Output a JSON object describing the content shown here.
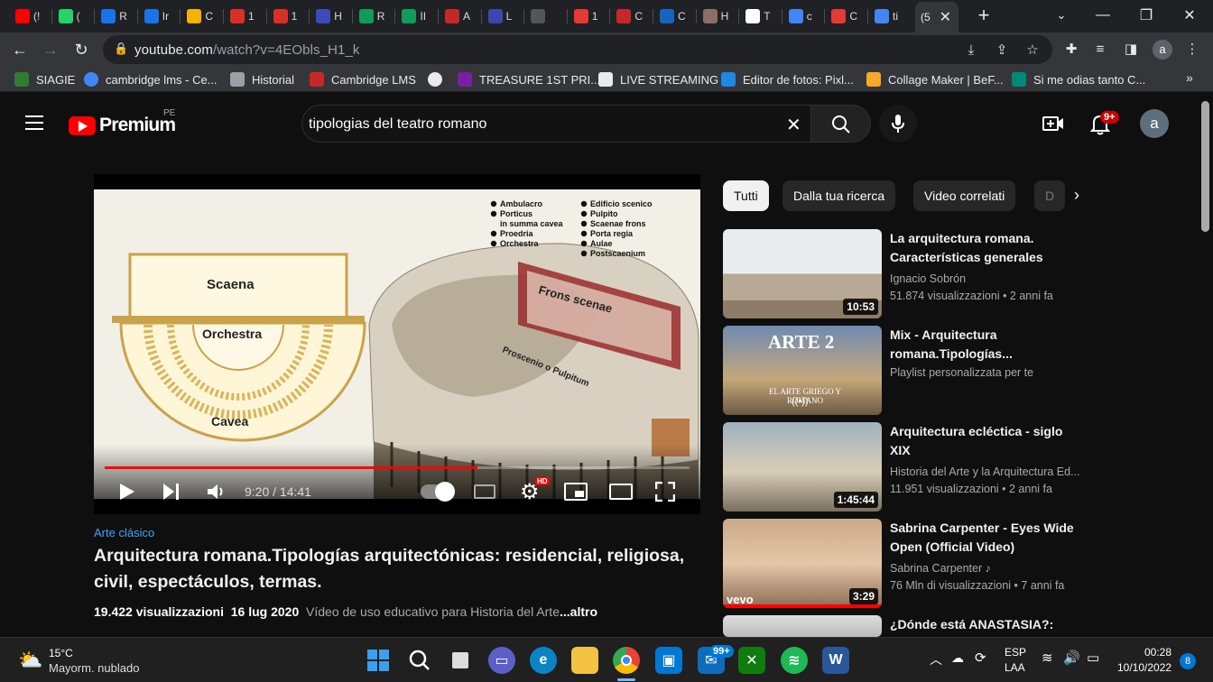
{
  "browser": {
    "tabs": [
      {
        "fav_color": "#ff0000",
        "label": "(!"
      },
      {
        "fav_color": "#25d366",
        "label": "("
      },
      {
        "fav_color": "#1a73e8",
        "label": "R"
      },
      {
        "fav_color": "#1a73e8",
        "label": "Ir"
      },
      {
        "fav_color": "#f4b400",
        "label": "C"
      },
      {
        "fav_color": "#d93025",
        "label": "1"
      },
      {
        "fav_color": "#d93025",
        "label": "1"
      },
      {
        "fav_color": "#3b4bb8",
        "label": "H"
      },
      {
        "fav_color": "#0f9d58",
        "label": "R"
      },
      {
        "fav_color": "#0f9d58",
        "label": "II"
      },
      {
        "fav_color": "#c62828",
        "label": "A"
      },
      {
        "fav_color": "#3949ab",
        "label": "L"
      },
      {
        "fav_color": "#555555",
        "label": ""
      },
      {
        "fav_color": "#e53935",
        "label": "1"
      },
      {
        "fav_color": "#c62828",
        "label": "C"
      },
      {
        "fav_color": "#1565c0",
        "label": "C"
      },
      {
        "fav_color": "#8d6e63",
        "label": "H"
      },
      {
        "fav_color": "#ffffff",
        "label": "T"
      },
      {
        "fav_color": "#4285f4",
        "label": "c"
      },
      {
        "fav_color": "#e53935",
        "label": "C"
      },
      {
        "fav_color": "#4285f4",
        "label": "ti"
      }
    ],
    "active_tab_label": "(5",
    "url_host": "youtube.com",
    "url_path": "/watch?v=4EObls_H1_k",
    "profile_initial": "a",
    "bookmarks": [
      {
        "label": "SIAGIE",
        "color": "#2e7d32"
      },
      {
        "label": "cambridge lms - Ce...",
        "color": "#4285f4"
      },
      {
        "label": "Historial",
        "color": "#9aa0a6"
      },
      {
        "label": "Cambridge LMS",
        "color": "#c62828"
      },
      {
        "label": "",
        "color": "#e8eaed"
      },
      {
        "label": "TREASURE 1ST PRI...",
        "color": "#7b1fa2"
      },
      {
        "label": "LIVE STREAMING",
        "color": "#e8eaed"
      },
      {
        "label": "Editor de fotos: Pixl...",
        "color": "#1e88e5"
      },
      {
        "label": "Collage Maker | BeF...",
        "color": "#f9a825"
      },
      {
        "label": "Si me odias tanto C...",
        "color": "#00897b"
      }
    ]
  },
  "youtube": {
    "logo_text": "Premium",
    "region": "PE",
    "search_value": "tipologias del teatro romano",
    "notif_count": "9+",
    "avatar_initial": "a"
  },
  "player": {
    "time": "9:20 / 14:41",
    "progress": 0.637,
    "frame": {
      "plan_labels": [
        "Scaena",
        "Orchestra",
        "Cavea"
      ],
      "legend_left": [
        "Ambulacro",
        "Porticus",
        "in summa cavea",
        "Proedria",
        "Orchestra"
      ],
      "legend_right": [
        "Edificio scenico",
        "Pulpito",
        "Scaenae frons",
        "Porta regia",
        "Aulae",
        "Postscaenium"
      ],
      "model_labels": [
        "Frons scenae",
        "Proscenio o Pulpitum"
      ]
    }
  },
  "video": {
    "hashtag": "Arte clásico",
    "title": "Arquitectura romana.Tipologías arquitectónicas: residencial, religiosa, civil, espectáculos, termas.",
    "views": "19.422 visualizzazioni",
    "date": "16 lug 2020",
    "desc": "Vídeo de uso educativo para Historia del Arte",
    "more": "...altro"
  },
  "chips": [
    "Tutti",
    "Dalla tua ricerca",
    "Video correlati",
    "D"
  ],
  "related": [
    {
      "title": "La arquitectura romana. Características generales",
      "channel": "Ignacio Sobrón",
      "meta": "51.874 visualizzazioni • 2 anni fa",
      "duration": "10:53"
    },
    {
      "title": "Mix - Arquitectura romana.Tipologías...",
      "channel": "Playlist personalizzata per te",
      "meta": "",
      "duration": "",
      "thumb_text": "ARTE 2",
      "thumb_sub": "EL ARTE GRIEGO Y ROMANO"
    },
    {
      "title": "Arquitectura ecléctica - siglo XIX",
      "channel": "Historia del Arte y la Arquitectura Ed...",
      "meta": "11.951 visualizzazioni • 2 anni fa",
      "duration": "1:45:44"
    },
    {
      "title": "Sabrina Carpenter - Eyes Wide Open (Official Video)",
      "channel": "Sabrina Carpenter ♪",
      "meta": "76 Mln di visualizzazioni • 7 anni fa",
      "duration": "3:29",
      "thumb_text": "vevo"
    },
    {
      "title": "¿Dónde está ANASTASIA?:",
      "channel": "",
      "meta": "",
      "duration": ""
    }
  ],
  "taskbar": {
    "weather_temp": "15°C",
    "weather_desc": "Mayorm. nublado",
    "mail_badge": "99+",
    "lang_top": "ESP",
    "lang_bottom": "LAA",
    "time": "00:28",
    "date": "10/10/2022",
    "notif": "8"
  }
}
